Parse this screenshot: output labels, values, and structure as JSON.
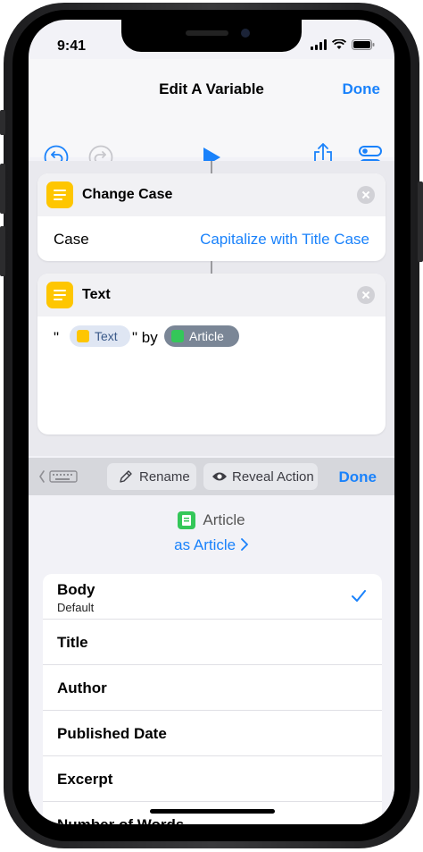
{
  "status": {
    "time": "9:41"
  },
  "nav": {
    "title": "Edit A Variable",
    "done_label": "Done"
  },
  "toolbar": {
    "icons": [
      "undo-icon",
      "redo-icon",
      "play-icon",
      "share-icon",
      "settings-toggle-icon"
    ]
  },
  "actions": [
    {
      "title": "Change Case",
      "row_label": "Case",
      "row_value": "Capitalize with Title Case"
    },
    {
      "title": "Text",
      "open_quote": "\"",
      "pill_text": "Text",
      "middle": "\" by",
      "pill_article": "Article"
    }
  ],
  "variable_bar": {
    "rename_label": "Rename",
    "reveal_label": "Reveal Action",
    "done_label": "Done"
  },
  "detail": {
    "name": "Article",
    "type_label": "as Article",
    "items": [
      {
        "label": "Body",
        "sub": "Default",
        "selected": true
      },
      {
        "label": "Title"
      },
      {
        "label": "Author"
      },
      {
        "label": "Published Date"
      },
      {
        "label": "Excerpt"
      },
      {
        "label": "Number of Words"
      }
    ]
  },
  "colors": {
    "accent": "#1a82fb",
    "action_yellow": "#fec601",
    "article_green": "#34c759"
  }
}
